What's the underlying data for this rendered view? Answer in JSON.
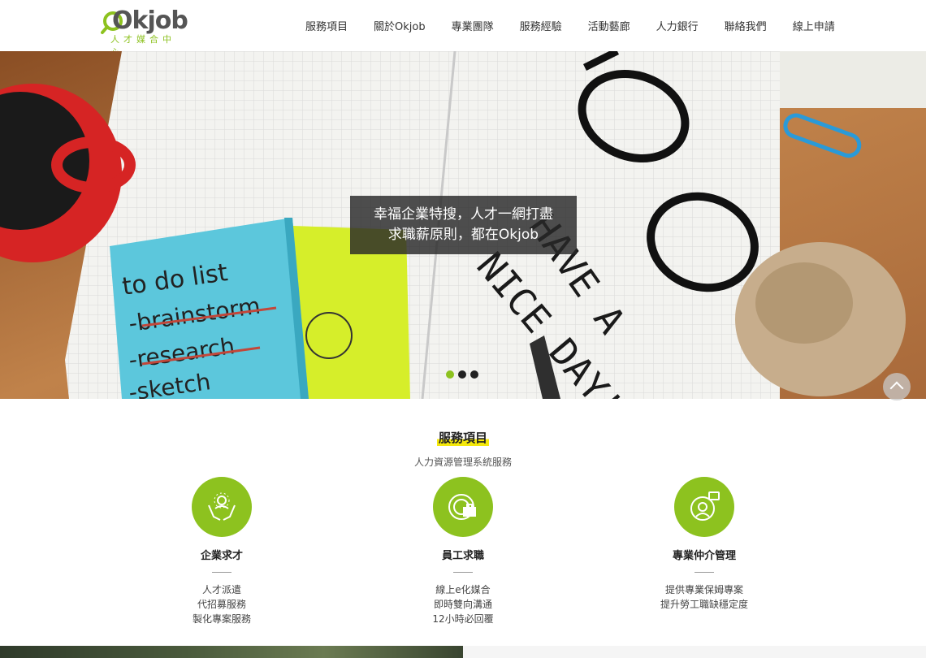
{
  "header": {
    "logo_text": "Okjob",
    "logo_sub": "人才媒合中心",
    "nav": [
      "服務項目",
      "關於Okjob",
      "專業團隊",
      "服務經驗",
      "活動藝廊",
      "人力銀行",
      "聯絡我們",
      "線上申請"
    ]
  },
  "hero": {
    "caption_line1": "幸福企業特搜，人才一網打盡",
    "caption_line2": "求職薪原則，都在Okjob",
    "note_text": [
      "to do list",
      "-brainstorm",
      "-research",
      "-sketch"
    ],
    "page_text": [
      "HAVE A",
      "NICE DAY!"
    ],
    "slides": 3,
    "active_slide": 1
  },
  "services": {
    "title": "服務項目",
    "subtitle": "人力資源管理系統服務",
    "items": [
      {
        "icon": "people-hands-icon",
        "name": "企業求才",
        "lines": [
          "人才派遣",
          "代招募服務",
          "製化專案服務"
        ]
      },
      {
        "icon": "target-briefcase-icon",
        "name": "員工求職",
        "lines": [
          "線上e化媒合",
          "即時雙向溝通",
          "12小時必回覆"
        ]
      },
      {
        "icon": "headset-agent-icon",
        "name": "專業仲介管理",
        "lines": [
          "提供專業保姆專案",
          "提升勞工職缺穩定度"
        ]
      }
    ]
  },
  "colors": {
    "accent": "#8dc21f",
    "highlight": "#f4e80b"
  }
}
